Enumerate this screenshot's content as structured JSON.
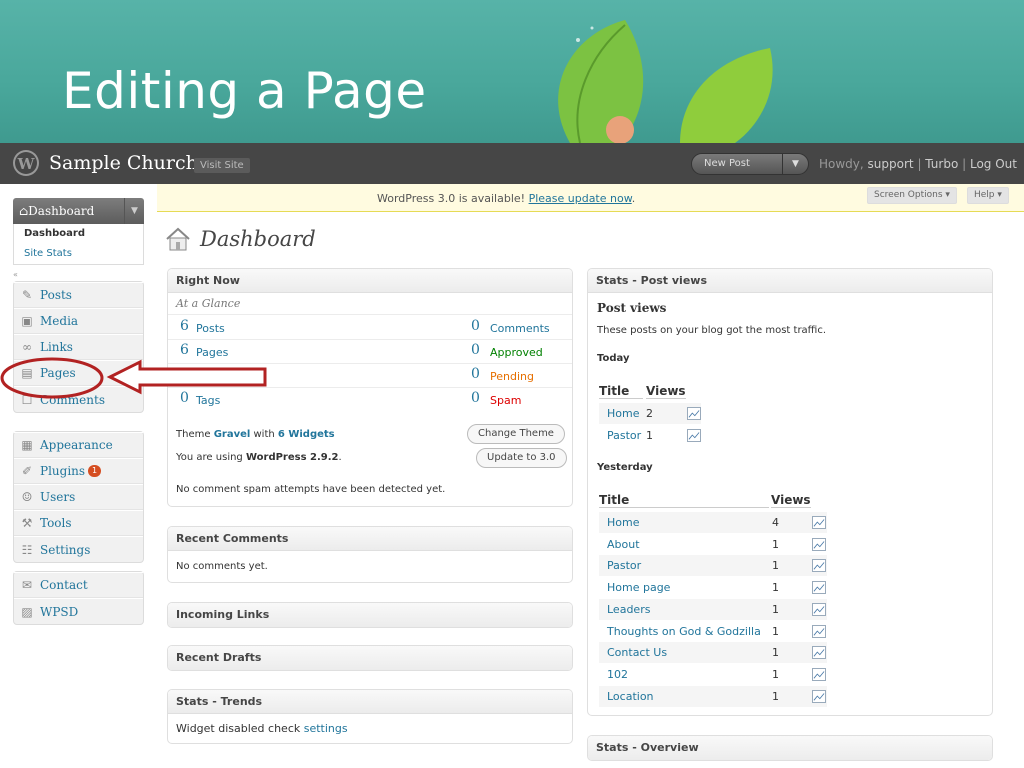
{
  "slide": {
    "title": "Editing a Page"
  },
  "header": {
    "site_title": "Sample Church",
    "visit_site": "Visit Site",
    "new_post": "New Post",
    "howdy": "Howdy,",
    "user": "support",
    "turbo": "Turbo",
    "logout": "Log Out"
  },
  "notice": {
    "text": "WordPress 3.0 is available!",
    "link": "Please update now",
    "period": "."
  },
  "top_buttons": {
    "screen_options": "Screen Options ▾",
    "help": "Help ▾"
  },
  "sidebar": {
    "dashboard": "Dashboard",
    "sub": [
      "Dashboard",
      "Site Stats"
    ],
    "group1": [
      {
        "label": "Posts",
        "icon": "pin-icon"
      },
      {
        "label": "Media",
        "icon": "media-icon"
      },
      {
        "label": "Links",
        "icon": "link-icon"
      },
      {
        "label": "Pages",
        "icon": "pages-icon"
      },
      {
        "label": "Comments",
        "icon": "comment-icon"
      }
    ],
    "group2": [
      {
        "label": "Appearance",
        "icon": "appearance-icon"
      },
      {
        "label": "Plugins",
        "icon": "plugin-icon",
        "badge": "1"
      },
      {
        "label": "Users",
        "icon": "users-icon"
      },
      {
        "label": "Tools",
        "icon": "tools-icon"
      },
      {
        "label": "Settings",
        "icon": "settings-icon"
      }
    ],
    "group3": [
      {
        "label": "Contact",
        "icon": "contact-icon"
      },
      {
        "label": "WPSD",
        "icon": "wpsd-icon"
      }
    ]
  },
  "page_title": "Dashboard",
  "right_now": {
    "title": "Right Now",
    "glance": "At a Glance",
    "content": [
      {
        "num": "6",
        "label": "Posts"
      },
      {
        "num": "6",
        "label": "Pages"
      },
      {
        "num": "",
        "label": ""
      },
      {
        "num": "0",
        "label": "Tags"
      }
    ],
    "discussion": [
      {
        "num": "0",
        "label": "Comments",
        "color": "#21759b"
      },
      {
        "num": "0",
        "label": "Approved",
        "color": "#008000"
      },
      {
        "num": "0",
        "label": "Pending",
        "color": "#e66f00"
      },
      {
        "num": "0",
        "label": "Spam",
        "color": "#dd0000"
      }
    ],
    "theme_pre": "Theme",
    "theme": "Gravel",
    "with": "with",
    "widgets": "6 Widgets",
    "change_theme": "Change Theme",
    "using_pre": "You are using",
    "version": "WordPress 2.9.2",
    "using_post": ".",
    "update_btn": "Update to 3.0",
    "spam_note": "No comment spam attempts have been detected yet."
  },
  "recent_comments": {
    "title": "Recent Comments",
    "text": "No comments yet."
  },
  "incoming_links": {
    "title": "Incoming Links"
  },
  "recent_drafts": {
    "title": "Recent Drafts"
  },
  "stats_trends": {
    "title": "Stats - Trends",
    "text": "Widget disabled check",
    "link": "settings"
  },
  "stats_post_views": {
    "title": "Stats - Post views",
    "heading": "Post views",
    "desc": "These posts on your blog got the most traffic.",
    "today_label": "Today",
    "col_title": "Title",
    "col_views": "Views",
    "today": [
      {
        "title": "Home",
        "views": "2"
      },
      {
        "title": "Pastor",
        "views": "1"
      }
    ],
    "yesterday_label": "Yesterday",
    "yesterday": [
      {
        "title": "Home",
        "views": "4"
      },
      {
        "title": "About",
        "views": "1"
      },
      {
        "title": "Pastor",
        "views": "1"
      },
      {
        "title": "Home page",
        "views": "1"
      },
      {
        "title": "Leaders",
        "views": "1"
      },
      {
        "title": "Thoughts on God & Godzilla",
        "views": "1"
      },
      {
        "title": "Contact Us",
        "views": "1"
      },
      {
        "title": "102",
        "views": "1"
      },
      {
        "title": "Location",
        "views": "1"
      }
    ]
  },
  "stats_overview": {
    "title": "Stats - Overview"
  },
  "colors": {
    "accent": "#21759b",
    "header": "#464646",
    "annotation": "#b22222",
    "banner": "#4fae a2"
  }
}
